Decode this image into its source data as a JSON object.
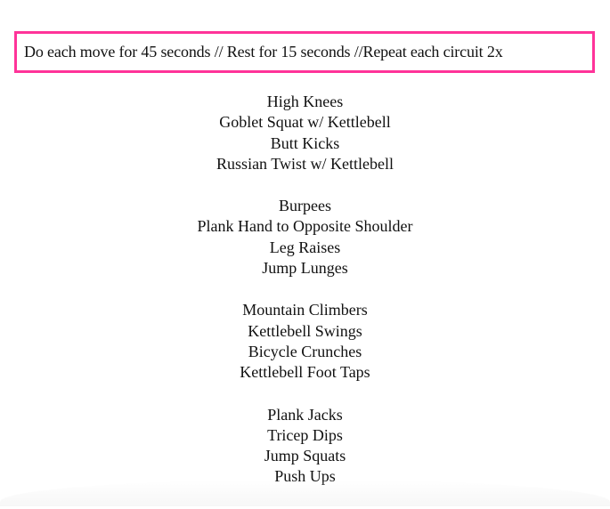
{
  "notice": {
    "text": "Do each move for 45 seconds // Rest for 15 seconds //Repeat each circuit 2x",
    "border_color": "#ff3399"
  },
  "circuits": [
    {
      "exercises": [
        "High Knees",
        "Goblet Squat w/ Kettlebell",
        "Butt Kicks",
        "Russian Twist w/ Kettlebell"
      ]
    },
    {
      "exercises": [
        "Burpees",
        "Plank Hand to Opposite Shoulder",
        "Leg Raises",
        "Jump Lunges"
      ]
    },
    {
      "exercises": [
        "Mountain Climbers",
        "Kettlebell Swings",
        "Bicycle Crunches",
        "Kettlebell Foot Taps"
      ]
    },
    {
      "exercises": [
        "Plank Jacks",
        "Tricep Dips",
        "Jump Squats",
        "Push Ups"
      ]
    }
  ]
}
